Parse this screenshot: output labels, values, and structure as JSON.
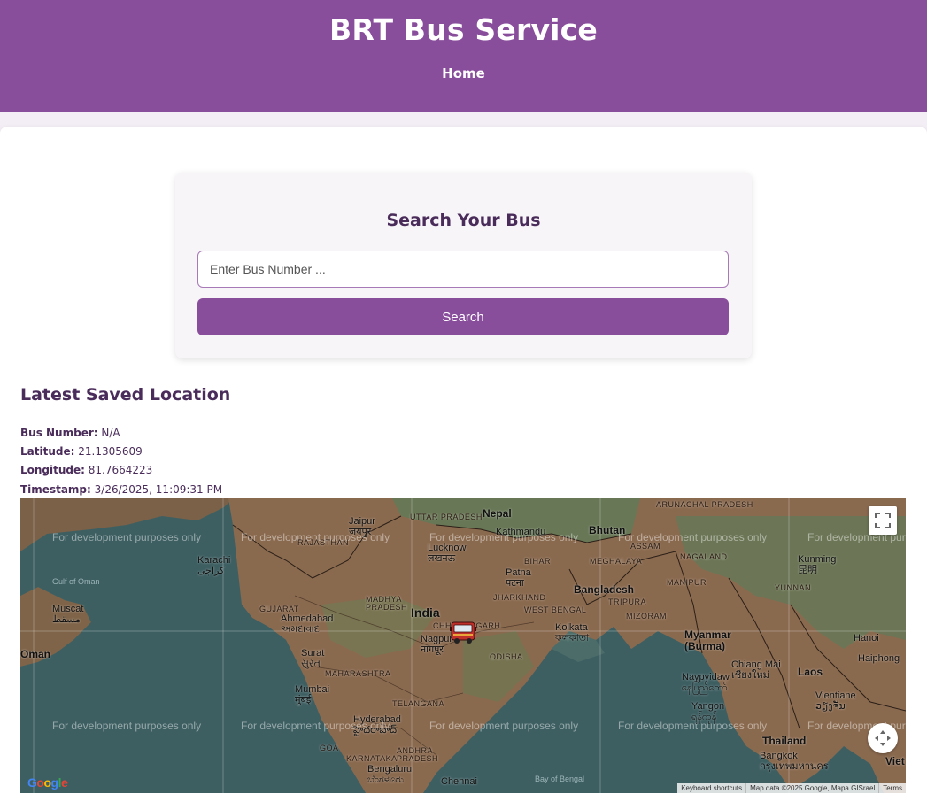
{
  "header": {
    "title": "BRT Bus Service",
    "nav_home": "Home"
  },
  "search": {
    "heading": "Search Your Bus",
    "placeholder": "Enter Bus Number ...",
    "value": "",
    "button_label": "Search"
  },
  "location": {
    "heading": "Latest Saved Location",
    "bus_number_label": "Bus Number:",
    "bus_number": "N/A",
    "latitude_label": "Latitude:",
    "latitude": "21.1305609",
    "longitude_label": "Longitude:",
    "longitude": "81.7664223",
    "timestamp_label": "Timestamp:",
    "timestamp": "3/26/2025, 11:09:31 PM"
  },
  "map": {
    "watermark": "For development purposes only",
    "google_logo": "Google",
    "footer": {
      "shortcuts": "Keyboard shortcuts",
      "data": "Map data ©2025 Google, Mapa GISrael",
      "terms": "Terms"
    },
    "labels": {
      "nepal": "Nepal",
      "jaipur": "Jaipur",
      "jaipur_local": "जयपुर",
      "karachi": "Karachi",
      "karachi_local": "كراچی",
      "gulf_of_oman": "Gulf of Oman",
      "muscat": "Muscat",
      "muscat_local": "مسقط",
      "oman": "Oman",
      "uttar_pradesh": "UTTAR PRADESH",
      "rajasthan": "RAJASTHAN",
      "kathmandu": "Kathmandu",
      "bhutan": "Bhutan",
      "lucknow": "Lucknow",
      "lucknow_local": "लखनऊ",
      "bihar": "BIHAR",
      "meghalaya": "MEGHALAYA",
      "assam": "ASSAM",
      "nagaland": "NAGALAND",
      "arunachal": "ARUNACHAL PRADESH",
      "kunming": "Kunming",
      "kunming_local": "昆明",
      "patna": "Patna",
      "patna_local": "पटना",
      "bangladesh": "Bangladesh",
      "manipur": "MANIPUR",
      "yunnan": "YUNNAN",
      "gujarat": "GUJARAT",
      "madhya_pradesh": "MADHYA PRADESH",
      "india": "India",
      "jharkhand": "JHARKHAND",
      "west_bengal": "WEST BENGAL",
      "tripura": "TRIPURA",
      "mizoram": "MIZORAM",
      "ahmedabad": "Ahmedabad",
      "ahmedabad_local": "અમદાવાદ",
      "chhattisgarh": "CHHATTISGARH",
      "kolkata": "Kolkata",
      "kolkata_local": "কলকাতা",
      "myanmar": "Myanmar",
      "myanmar_local": "(Burma)",
      "hanoi": "Hanoi",
      "haiphong": "Haiphong",
      "surat": "Surat",
      "surat_local": "સુરત",
      "nagpur": "Nagpur",
      "nagpur_local": "नागपूर",
      "odisha": "ODISHA",
      "maharashtra": "MAHARASHTRA",
      "chiang_mai": "Chiang Mai",
      "chiang_mai_local": "เชียงใหม่",
      "naypyidaw": "Naypyidaw",
      "naypyidaw_local": "နေပြည်တော်",
      "laos": "Laos",
      "mumbai": "Mumbai",
      "mumbai_local": "मुंबई",
      "telangana": "TELANGANA",
      "yangon": "Yangon",
      "yangon_local": "ရန်ကုန်",
      "vientiane": "Vientiane",
      "vientiane_local": "ວຽງຈັນ",
      "hyderabad": "Hyderabad",
      "hyderabad_local": "హైదరాబాద్",
      "goa": "GOA",
      "andhra_pradesh": "ANDHRA PRADESH",
      "karnataka": "KARNATAKA",
      "thailand": "Thailand",
      "bangkok": "Bangkok",
      "bangkok_local": "กรุงเทพมหานคร",
      "viet": "Viet",
      "bengaluru": "Bengaluru",
      "bengaluru_local": "ಬೆಂಗಳೂರು",
      "chennai": "Chennai",
      "bay_of_bengal": "Bay of Bengal"
    }
  },
  "colors": {
    "brand": "#884d9b",
    "heading_text": "#4a2c5a",
    "map_water": "#3e5f62",
    "map_land": "#8a6a4f"
  }
}
